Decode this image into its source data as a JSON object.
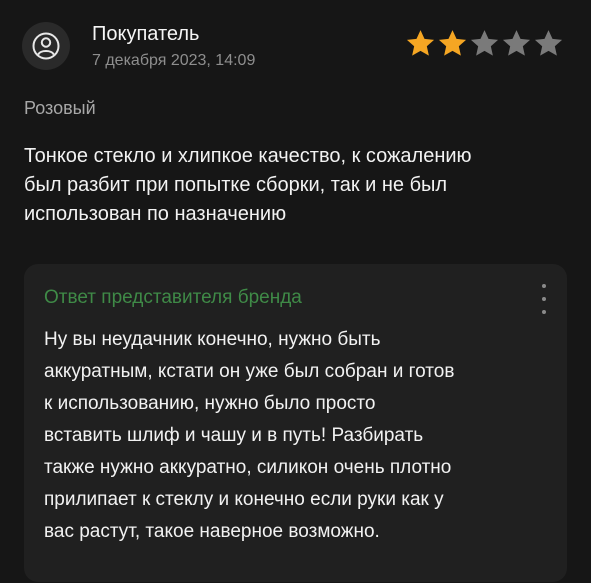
{
  "review": {
    "author": "Покупатель",
    "date": "7 декабря 2023, 14:09",
    "rating": 2,
    "rating_max": 5,
    "variant": "Розовый",
    "text_lines": [
      "Тонкое стекло и хлипкое качество, к сожалению",
      "был разбит при попытке сборки, так и не был",
      "использован по назначению"
    ]
  },
  "brand_reply": {
    "title": "Ответ представителя бренда",
    "text_lines": [
      "Ну вы неудачник конечно, нужно быть",
      "аккуратным, кстати он уже был собран и готов",
      "к использованию, нужно было просто",
      "вставить шлиф и чашу и в путь! Разбирать",
      "также нужно аккуратно, силикон очень плотно",
      "прилипает к стеклу и конечно если руки как у",
      "вас растут, такое наверное возможно."
    ]
  },
  "colors": {
    "background": "#161616",
    "reply_background": "#202020",
    "star_filled": "#f5a623",
    "star_empty": "#7a7a7a",
    "reply_title": "#3f8a47",
    "secondary_text": "#8e8e8e"
  },
  "icons": {
    "avatar": "user-circle-icon",
    "star": "star-icon",
    "menu": "more-vertical-icon"
  }
}
